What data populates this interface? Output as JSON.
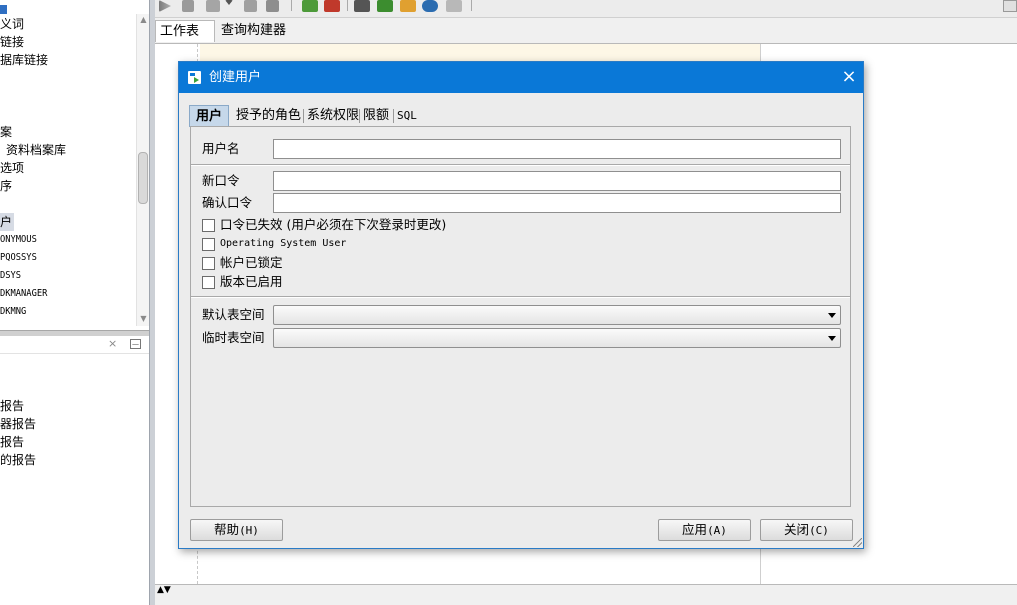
{
  "navigator": {
    "tree_items": [
      "义词",
      "链接",
      "据库链接",
      "案",
      "资料档案库",
      "选项",
      "序",
      "户",
      "ONYMOUS",
      "PQOSSYS",
      "DSYS",
      "DKMANAGER",
      "DKMNG"
    ],
    "close_glyph": "×",
    "reports": [
      "报告",
      "器报告",
      "报告",
      "的报告"
    ]
  },
  "worksheet": {
    "tabs": [
      "工作表",
      "查询构建器"
    ],
    "bottom_arrows": "▲▼"
  },
  "dialog": {
    "title": "创建用户",
    "close_glyph": "×",
    "tabs": [
      "用户",
      "授予的角色",
      "系统权限",
      "限额",
      "SQL"
    ],
    "active_tab": "用户",
    "fields": {
      "username_label": "用户名",
      "username_value": "",
      "new_password_label": "新口令",
      "new_password_value": "",
      "confirm_password_label": "确认口令",
      "confirm_password_value": ""
    },
    "checkboxes": [
      {
        "label": "口令已失效 (用户必须在下次登录时更改)",
        "checked": false
      },
      {
        "label": "Operating System User",
        "checked": false
      },
      {
        "label": "帐户已锁定",
        "checked": false
      },
      {
        "label": "版本已启用",
        "checked": false
      }
    ],
    "tablespaces": {
      "default_label": "默认表空间",
      "default_value": "",
      "temp_label": "临时表空间",
      "temp_value": ""
    },
    "buttons": {
      "help": "帮助",
      "help_mnemonic": "(H)",
      "apply": "应用",
      "apply_mnemonic": "(A)",
      "close": "关闭",
      "close_mnemonic": "(C)"
    }
  },
  "colors": {
    "titlebar": "#0a78d7",
    "active_tab": "#c6d8ea",
    "editor_highlight": "#fdf7e6"
  }
}
